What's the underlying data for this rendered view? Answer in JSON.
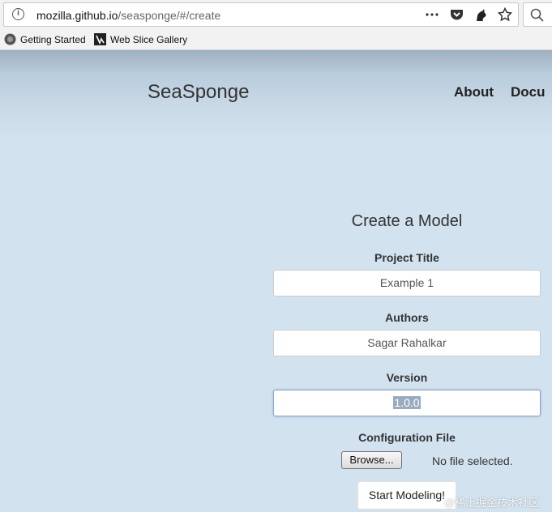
{
  "browser": {
    "url_host": "mozilla.github.io",
    "url_path": "/seasponge/#/create",
    "info_icon": "i",
    "bookmarks": [
      {
        "label": "Getting Started",
        "icon": "firefox-icon"
      },
      {
        "label": "Web Slice Gallery",
        "icon": "web-slice-icon"
      }
    ]
  },
  "header": {
    "brand": "SeaSponge",
    "nav": [
      "About",
      "Docu"
    ]
  },
  "form": {
    "title": "Create a Model",
    "project_title_label": "Project Title",
    "project_title_value": "Example 1",
    "authors_label": "Authors",
    "authors_value": "Sagar Rahalkar",
    "version_label": "Version",
    "version_value": "1.0.0",
    "config_label": "Configuration File",
    "browse_label": "Browse...",
    "no_file_text": "No file selected.",
    "submit_label": "Start Modeling!"
  },
  "watermark": "@稀土掘金技术社区",
  "colors": {
    "page_bg": "#d2e2ef",
    "text": "#333333"
  }
}
